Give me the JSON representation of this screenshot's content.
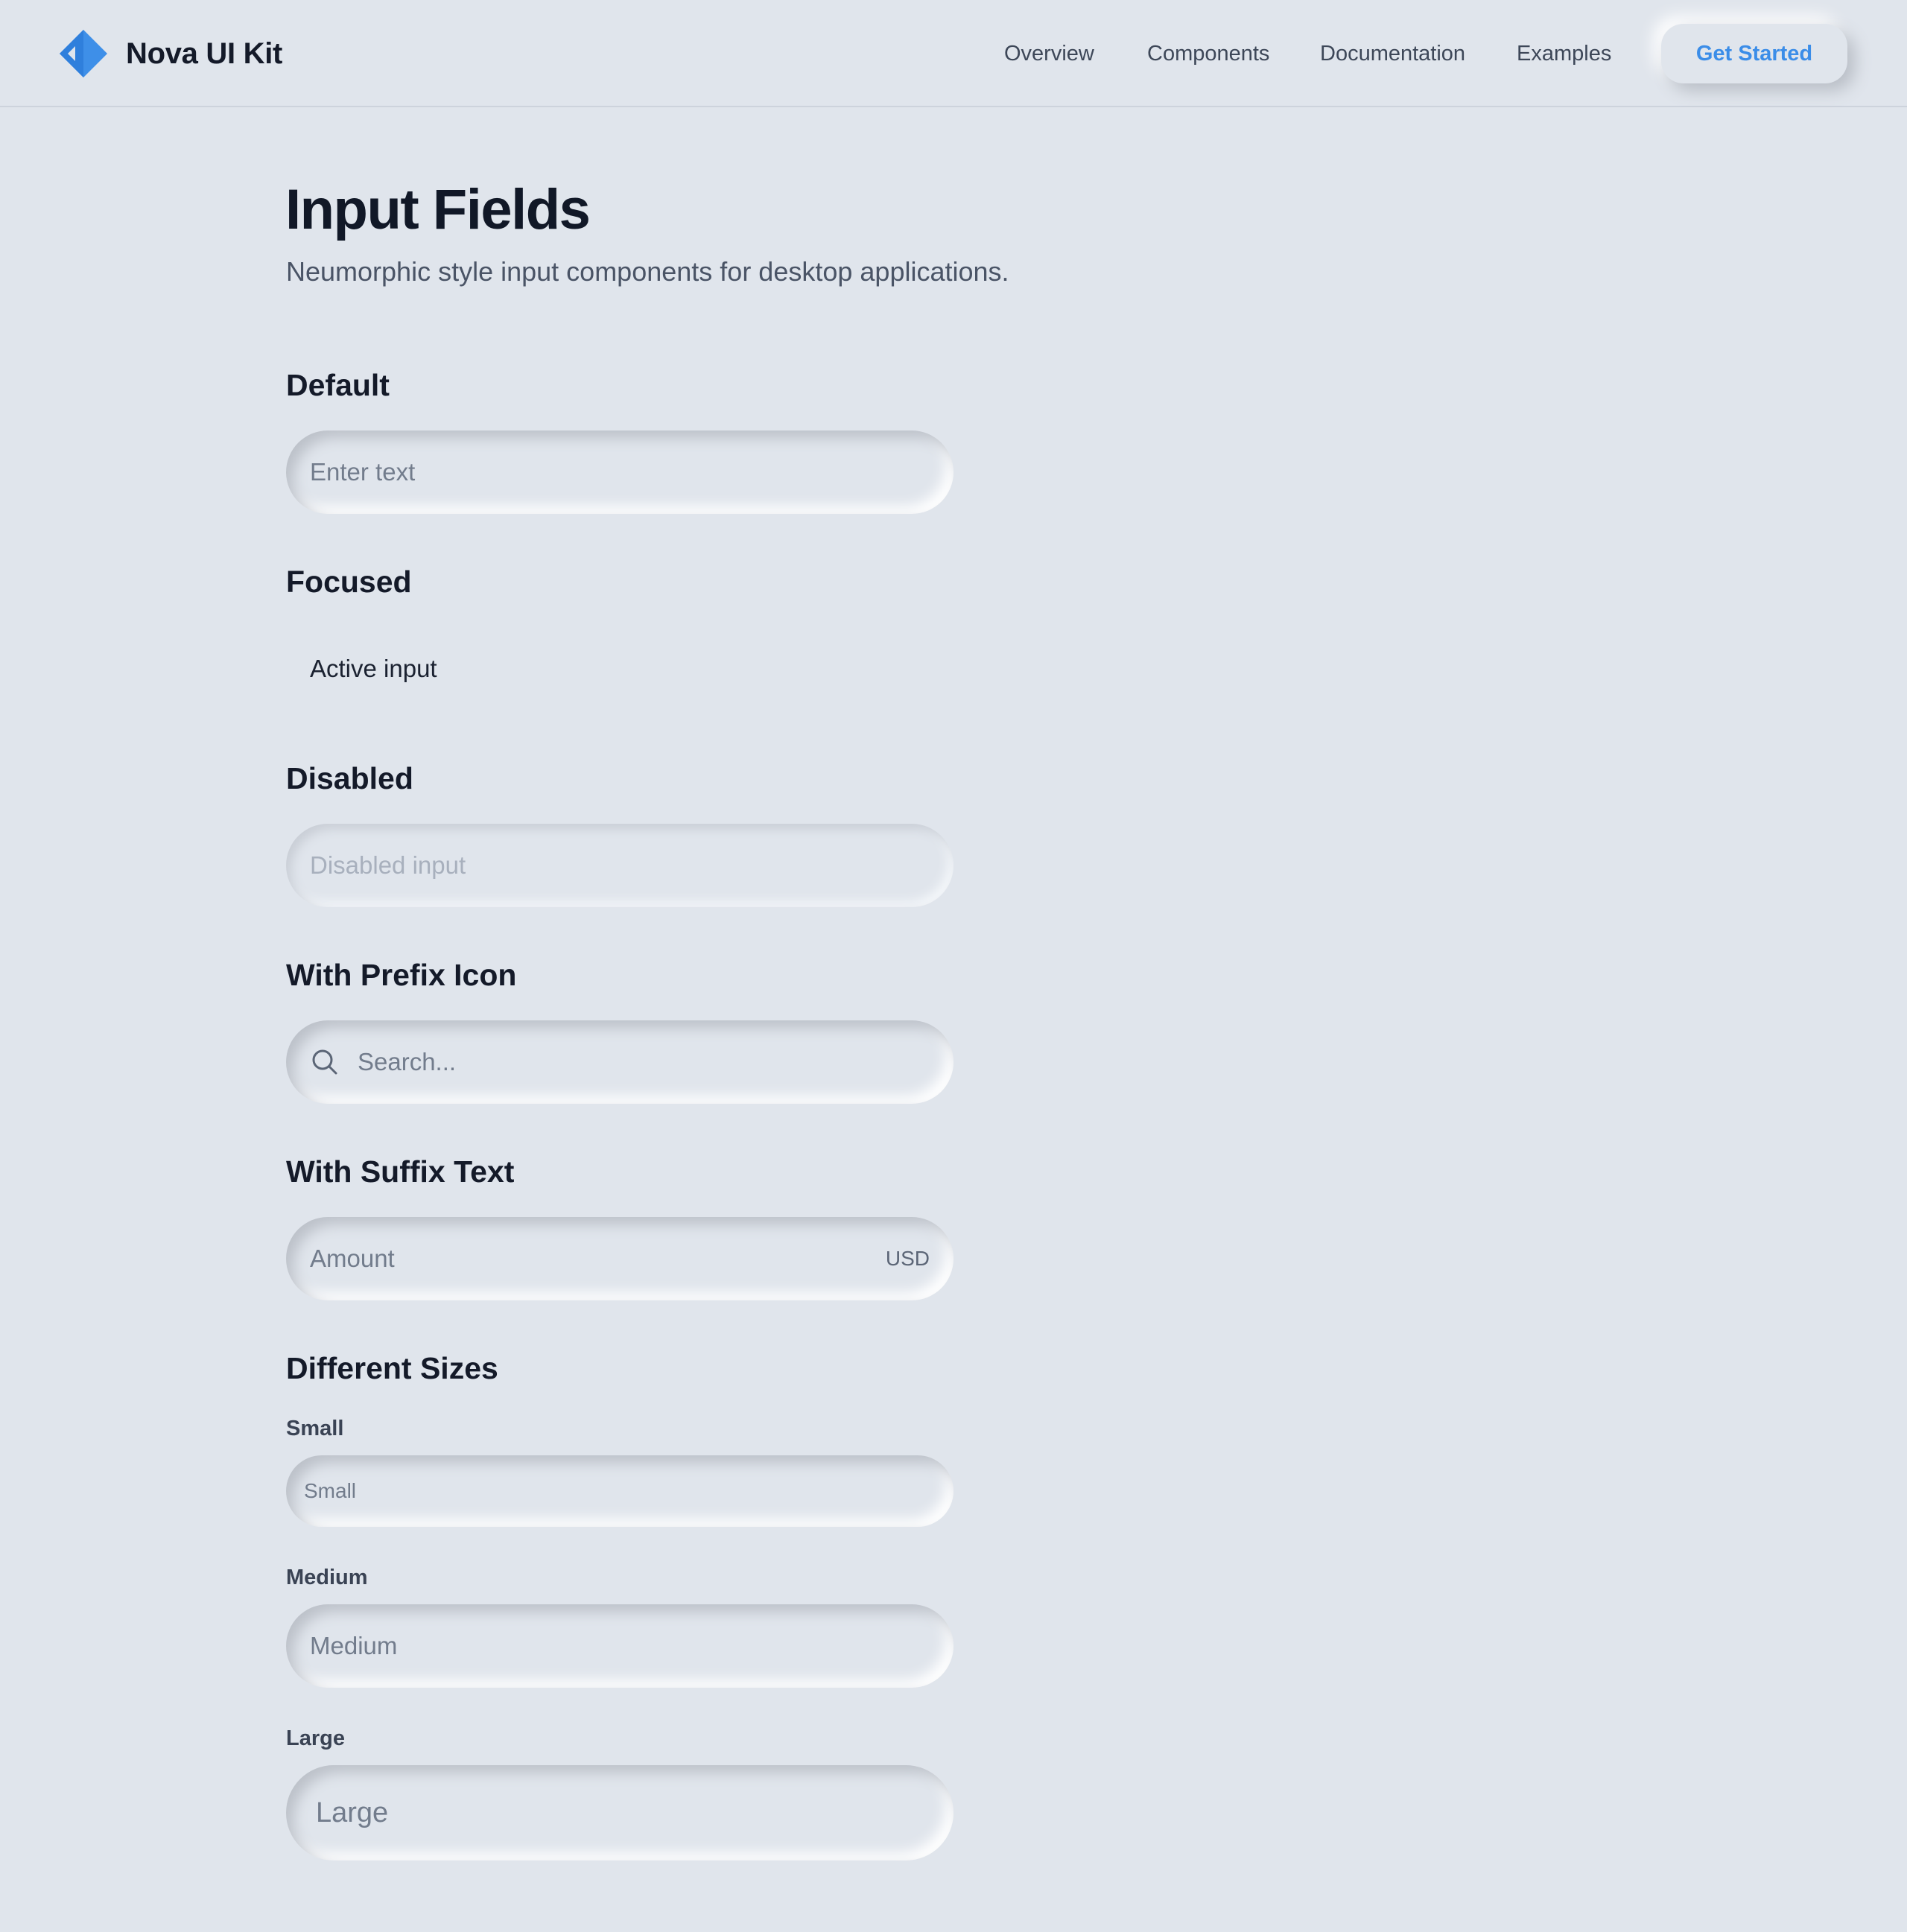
{
  "header": {
    "brand_name": "Nova UI Kit",
    "nav": [
      {
        "label": "Overview"
      },
      {
        "label": "Components"
      },
      {
        "label": "Documentation"
      },
      {
        "label": "Examples"
      }
    ],
    "cta_label": "Get Started"
  },
  "page": {
    "title": "Input Fields",
    "subtitle": "Neumorphic style input components for desktop applications."
  },
  "sections": {
    "default": {
      "title": "Default",
      "placeholder": "Enter text"
    },
    "focused": {
      "title": "Focused",
      "value": "Active input"
    },
    "disabled": {
      "title": "Disabled",
      "placeholder": "Disabled input"
    },
    "prefix": {
      "title": "With Prefix Icon",
      "placeholder": "Search...",
      "icon": "search-icon"
    },
    "suffix": {
      "title": "With Suffix Text",
      "placeholder": "Amount",
      "suffix_text": "USD"
    },
    "sizes": {
      "title": "Different Sizes",
      "small_label": "Small",
      "small_placeholder": "Small",
      "medium_label": "Medium",
      "medium_placeholder": "Medium",
      "large_label": "Large",
      "large_placeholder": "Large"
    }
  },
  "colors": {
    "background": "#e0e5ec",
    "accent": "#3b8de8",
    "text_primary": "#141a29",
    "text_muted": "#727c8c"
  }
}
